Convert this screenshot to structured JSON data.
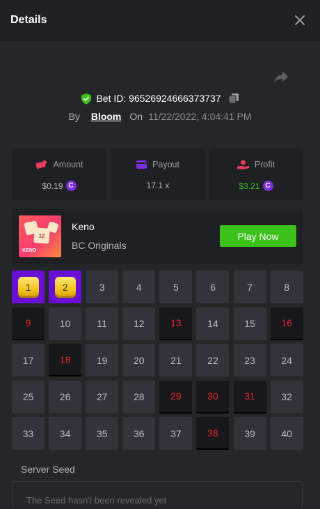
{
  "header": {
    "title": "Details"
  },
  "bet": {
    "id_label": "Bet ID: 96526924666373737",
    "by_label": "By",
    "user": "Bloom",
    "on_label": "On",
    "time": "11/22/2022, 4:04:41 PM"
  },
  "stats": {
    "amount": {
      "label": "Amount",
      "value": "$0.19"
    },
    "payout": {
      "label": "Payout",
      "value": "17.1 x"
    },
    "profit": {
      "label": "Profit",
      "value": "$3.21"
    }
  },
  "game": {
    "name": "Keno",
    "provider": "BC Originals",
    "thumb_label": "KENO",
    "thumb_tile": "12",
    "play_label": "Play Now"
  },
  "board": {
    "numbers": [
      "1",
      "2",
      "3",
      "4",
      "5",
      "6",
      "7",
      "8",
      "9",
      "10",
      "11",
      "12",
      "13",
      "14",
      "15",
      "16",
      "17",
      "18",
      "19",
      "20",
      "21",
      "22",
      "23",
      "24",
      "25",
      "26",
      "27",
      "28",
      "29",
      "30",
      "31",
      "32",
      "33",
      "34",
      "35",
      "36",
      "37",
      "38",
      "39",
      "40"
    ],
    "selected": [
      "1",
      "2"
    ],
    "drawn_hits": [
      "9",
      "13",
      "16",
      "18",
      "29",
      "30",
      "31",
      "38"
    ]
  },
  "seed": {
    "title": "Server Seed",
    "text": "The Seed hasn't been revealed yet"
  },
  "icons": {
    "close": "close-icon",
    "share": "share-icon",
    "verified": "shield-check-icon",
    "copy": "copy-icon",
    "amount": "money-icon",
    "payout": "card-icon",
    "profit": "hand-coin-icon",
    "coin": "bc-coin-icon"
  },
  "colors": {
    "accent_green": "#3bc117",
    "selected_purple": "#6a0fd6",
    "hit_red": "#e8232b",
    "profit_green": "#3bc117",
    "amount_red": "#ea3b5c",
    "payout_purple": "#7b2fe0"
  }
}
